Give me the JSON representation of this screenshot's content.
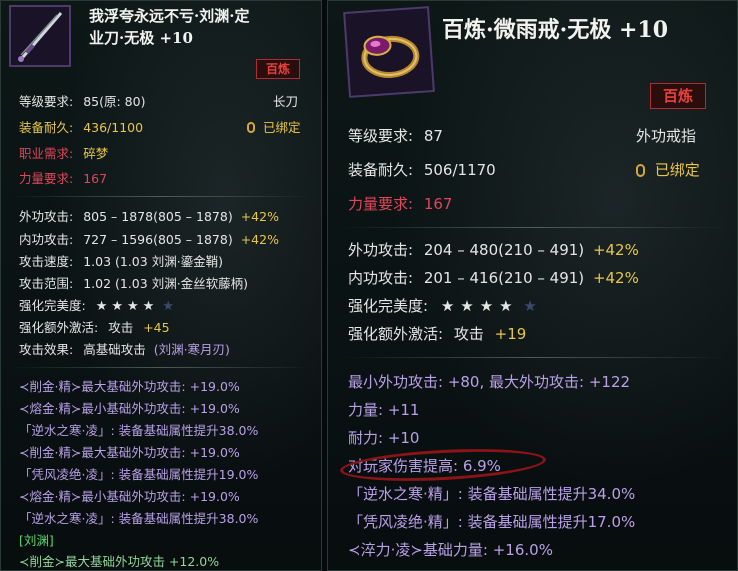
{
  "left": {
    "title_line1": "我浮夸永远不亏·刘渊·定",
    "title_line2": "业刀·无极 +10",
    "badge": "百炼",
    "level_label": "等级要求:",
    "level_value": "85(原: 80)",
    "weapon_type": "长刀",
    "durability_label": "装备耐久:",
    "durability_value": "436/1100",
    "bound": "已绑定",
    "class_label": "职业需求:",
    "class_value": "碎梦",
    "str_label": "力量要求:",
    "str_value": "167",
    "stats": [
      {
        "label": "外功攻击:",
        "value": "805 – 1878(805 – 1878)",
        "bonus": "+42%"
      },
      {
        "label": "内功攻击:",
        "value": "727 – 1596(805 – 1878)",
        "bonus": "+42%"
      },
      {
        "label": "攻击速度:",
        "value": "1.03 (1.03 刘渊·鎏金鞘)",
        "bonus": ""
      },
      {
        "label": "攻击范围:",
        "value": "1.02 (1.03 刘渊·金丝软藤柄)",
        "bonus": ""
      }
    ],
    "perfection_label": "强化完美度:",
    "stars": "★★★★",
    "stars_value": 4,
    "extra_label": "强化额外激活:",
    "extra_stat": "攻击",
    "extra_value": "+45",
    "effect_label": "攻击效果:",
    "effect_value": "高基础攻击",
    "effect_source": "(刘渊·寒月刃)",
    "attrs": [
      "≺削金·精≻最大基础外功攻击: +19.0%",
      "≺熔金·精≻最小基础外功攻击: +19.0%",
      "「逆水之寒·凌」: 装备基础属性提升38.0%",
      "≺削金·精≻最大基础外功攻击: +19.0%",
      "「凭风凌绝·凌」: 装备基础属性提升19.0%",
      "≺熔金·精≻最小基础外功攻击: +19.0%",
      "「逆水之寒·凌」: 装备基础属性提升38.0%"
    ],
    "footer_tag": "[刘渊]",
    "footer_line": "≺削金≻最大基础外功攻击 +12.0%"
  },
  "right": {
    "title": "百炼·微雨戒·无极 +10",
    "badge": "百炼",
    "level_label": "等级要求:",
    "level_value": "87",
    "item_type": "外功戒指",
    "durability_label": "装备耐久:",
    "durability_value": "506/1170",
    "bound": "已绑定",
    "str_label": "力量要求:",
    "str_value": "167",
    "stats": [
      {
        "label": "外功攻击:",
        "value": "204 – 480(210 – 491)",
        "bonus": "+42%"
      },
      {
        "label": "内功攻击:",
        "value": "201 – 416(210 – 491)",
        "bonus": "+42%"
      }
    ],
    "perfection_label": "强化完美度:",
    "stars": "★★★★",
    "stars_value": 4,
    "extra_label": "强化额外激活:",
    "extra_stat": "攻击",
    "extra_value": "+19",
    "attrs": [
      "最小外功攻击: +80, 最大外功攻击: +122",
      "力量: +11",
      "耐力: +10",
      "对玩家伤害提高: 6.9%"
    ],
    "bonus_attrs": [
      "「逆水之寒·精」: 装备基础属性提升34.0%",
      "「凭风凌绝·精」: 装备基础属性提升17.0%",
      "≺淬力·凌≻基础力量: +16.0%"
    ]
  }
}
